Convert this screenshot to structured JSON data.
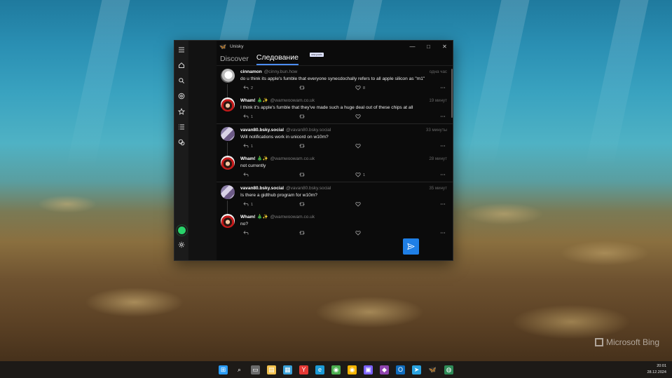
{
  "window": {
    "app_title": "Unisky",
    "controls": {
      "minimize": "—",
      "maximize": "□",
      "close": "✕"
    }
  },
  "rail": {
    "items": [
      {
        "name": "menu-icon"
      },
      {
        "name": "home-icon"
      },
      {
        "name": "search-icon"
      },
      {
        "name": "mentions-icon"
      },
      {
        "name": "favorites-icon"
      },
      {
        "name": "lists-icon"
      },
      {
        "name": "messages-icon"
      }
    ],
    "status_color": "#29d36a"
  },
  "tabs": [
    {
      "label": "Discover",
      "active": false
    },
    {
      "label": "Следование",
      "active": true
    }
  ],
  "tab_badge": "new posts",
  "posts": [
    {
      "avatar": "cinnamon",
      "name": "cinnamon",
      "handle": "@cinny.bun.how",
      "time": "одна час",
      "text": "do u think its apple's fumble that everyone synecdochally refers to all apple silicon as \"m1\"",
      "replies": "2",
      "likes": "8",
      "thread": true
    },
    {
      "avatar": "wham",
      "name": "Wham! 🎄✨",
      "handle": "@wamwoowam.co.uk",
      "time": "19 минут",
      "text": "I think it's apple's fumble that they've made such a huge deal out of these chips at all",
      "replies": "1",
      "likes": "",
      "thread": false
    },
    {
      "avatar": "vavan",
      "name": "vavan80.bsky.social",
      "handle": "@vavan80.bsky.social",
      "time": "33 минуты",
      "text": "Will notifications work in unicord on w10m?",
      "replies": "1",
      "likes": "",
      "thread": true
    },
    {
      "avatar": "wham",
      "name": "Wham! 🎄✨",
      "handle": "@wamwoowam.co.uk",
      "time": "28 минут",
      "text": "not currently",
      "replies": "",
      "likes": "1",
      "thread": false
    },
    {
      "avatar": "vavan",
      "name": "vavan80.bsky.social",
      "handle": "@vavan80.bsky.social",
      "time": "35 минут",
      "text": "Is there a gidthub program for w10m?",
      "replies": "1",
      "likes": "",
      "thread": true
    },
    {
      "avatar": "wham",
      "name": "Wham! 🎄✨",
      "handle": "@wamwoowam.co.uk",
      "time": "",
      "text": "no?",
      "replies": "",
      "likes": "",
      "thread": false
    }
  ],
  "desktop": {
    "watermark": "Microsoft Bing"
  },
  "taskbar": {
    "apps": [
      {
        "name": "start-icon",
        "color": "#2b9cf5",
        "glyph": "⊞"
      },
      {
        "name": "search-taskbar-icon",
        "color": "transparent",
        "glyph": "⌕"
      },
      {
        "name": "task-view-icon",
        "color": "#6b6b6b",
        "glyph": "▭"
      },
      {
        "name": "file-explorer-icon",
        "color": "#f2c14e",
        "glyph": "▤"
      },
      {
        "name": "notepad-icon",
        "color": "#3aa0d8",
        "glyph": "▦"
      },
      {
        "name": "yandex-browser-icon",
        "color": "#e53935",
        "glyph": "Y"
      },
      {
        "name": "edge-icon",
        "color": "#1b9ad6",
        "glyph": "e"
      },
      {
        "name": "chrome-icon",
        "color": "#4caf50",
        "glyph": "◉"
      },
      {
        "name": "chrome-beta-icon",
        "color": "#f4b400",
        "glyph": "◉"
      },
      {
        "name": "floppy-app-icon",
        "color": "#7b61ff",
        "glyph": "▣"
      },
      {
        "name": "visual-studio-icon",
        "color": "#8e44ad",
        "glyph": "◆"
      },
      {
        "name": "outlook-icon",
        "color": "#0f6cbd",
        "glyph": "O"
      },
      {
        "name": "telegram-icon",
        "color": "#2aa3e0",
        "glyph": "➤"
      },
      {
        "name": "unisky-taskbar-icon",
        "color": "transparent",
        "glyph": "🦋"
      },
      {
        "name": "globe-app-icon",
        "color": "#2e8b57",
        "glyph": "◍"
      }
    ],
    "time": "20:01",
    "date": "28.12.2024"
  }
}
